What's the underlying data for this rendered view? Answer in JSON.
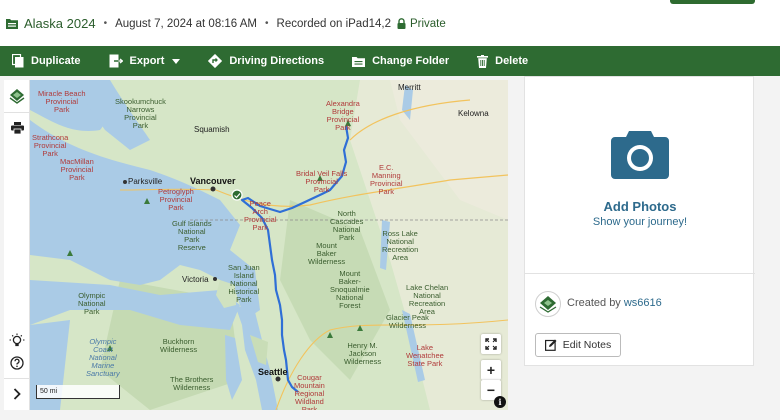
{
  "header": {
    "title": "Alaska 2024",
    "date": "August 7, 2024 at 08:16 AM",
    "recorded": "Recorded on iPad14,2",
    "privacy": "Private",
    "separator": "•"
  },
  "toolbar": {
    "duplicate": "Duplicate",
    "export": "Export",
    "driving_directions": "Driving Directions",
    "change_folder": "Change Folder",
    "delete": "Delete"
  },
  "map": {
    "scale": "50 mi",
    "zoom_in": "+",
    "zoom_out": "−",
    "info": "i",
    "labels": {
      "miracle_beach": "Miracle Beach\nProvincial\nPark",
      "skookumchuck": "Skookumchuck\nNarrows\nProvincial\nPark",
      "alexandra": "Alexandra\nBridge\nProvincial\nPark",
      "merritt": "Merritt",
      "kelowna": "Kelowna",
      "squamish": "Squamish",
      "strathcona": "Strathcona\nProvincial\nPark",
      "macmillan": "MacMillan\nProvincial\nPark",
      "parksville": "Parksville",
      "petroglyph": "Petroglyph\nProvincial\nPark",
      "vancouver": "Vancouver",
      "bridal_veil": "Bridal Veil Falls\nProvincial\nPark",
      "ec_manning": "E.C.\nManning\nProvincial\nPark",
      "peace_arch": "Peace\nArch\nProvincial\nPark",
      "north_cascades": "North\nCascades\nNational\nPark",
      "gulf_islands": "Gulf Islands\nNational\nPark\nReserve",
      "ross_lake": "Ross Lake\nNational\nRecreation\nArea",
      "mount_baker_wilderness": "Mount\nBaker\nWilderness",
      "victoria": "Victoria",
      "san_juan": "San Juan\nIsland\nNational\nHistorical\nPark",
      "mount_baker_snoqualmie": "Mount\nBaker-\nSnoqualmie\nNational\nForest",
      "olympic": "Olympic\nNational\nPark",
      "lake_chelan": "Lake Chelan\nNational\nRecreation\nArea",
      "glacier_peak": "Glacier Peak\nWilderness",
      "olympic_coast": "Olympic\nCoast\nNational\nMarine\nSanctuary",
      "buckhorn": "Buckhorn\nWilderness",
      "henry_jackson": "Henry M.\nJackson\nWilderness",
      "lake_wenatchee": "Lake\nWenatchee\nState Park",
      "the_brothers": "The Brothers\nWilderness",
      "seattle": "Seattle",
      "cougar": "Cougar\nMountain\nRegional\nWildland\nPark"
    }
  },
  "right": {
    "add_photos": "Add Photos",
    "show_journey": "Show your journey!",
    "created_by": "Created by",
    "user": "ws6616",
    "edit_notes": "Edit Notes"
  },
  "colors": {
    "brand_green": "#2e6b32",
    "link_blue": "#2d6a8c",
    "route_blue": "#2f6fd6"
  }
}
